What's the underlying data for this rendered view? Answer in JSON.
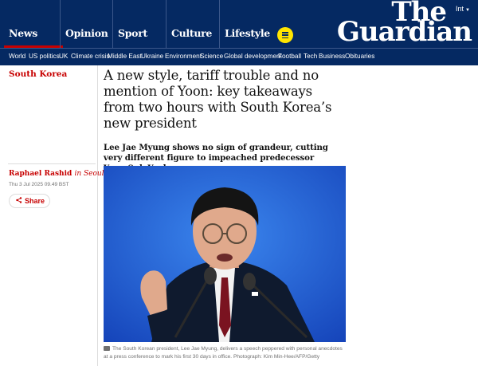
{
  "masthead": {
    "edition": "Int",
    "logo_line1": "The",
    "logo_line2": "Guardian",
    "pillars": [
      {
        "label": "News",
        "active": true
      },
      {
        "label": "Opinion"
      },
      {
        "label": "Sport"
      },
      {
        "label": "Culture"
      },
      {
        "label": "Lifestyle"
      }
    ],
    "colors": {
      "background": "#052962",
      "accent": "#c70000",
      "menu_button": "#ffe500"
    }
  },
  "subnav": {
    "items": [
      "World",
      "US politics",
      "UK",
      "Climate crisis",
      "Middle East",
      "Ukraine",
      "Environment",
      "Science",
      "Global development",
      "Football",
      "Tech",
      "Business",
      "Obituaries"
    ]
  },
  "article": {
    "section": "South Korea",
    "headline": "A new style, tariff trouble and no mention of Yoon: key takeaways from two hours with South Korea’s new president",
    "standfirst": "Lee Jae Myung shows no sign of grandeur, cutting very different figure to impeached predecessor Yoon Suk Yeol",
    "author": "Raphael Rashid",
    "location": "in Seoul",
    "date": "Thu 3 Jul 2025 09.49 BST",
    "share_label": "Share",
    "caption": "The South Korean president, Lee Jae Myung, delivers a speech peppered with personal anecdotes at a press conference to mark his first 30 days in office. Photograph: Kim Min-Hee/AFP/Getty"
  }
}
